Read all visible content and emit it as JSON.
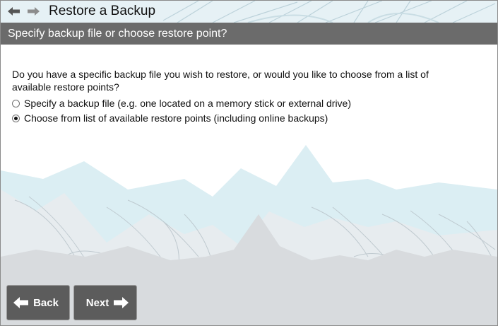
{
  "window": {
    "title": "Restore a Backup",
    "subheader": "Specify backup file or choose restore point?"
  },
  "nav": {
    "back_icon": "arrow-left-icon",
    "forward_icon": "arrow-right-icon"
  },
  "content": {
    "question": "Do you have a specific backup file you wish to restore, or would you like to choose from a list of available restore points?",
    "options": [
      {
        "label": "Specify a backup file (e.g. one located on a memory stick or external drive)",
        "selected": false
      },
      {
        "label": "Choose from list of available restore points (including online backups)",
        "selected": true
      }
    ]
  },
  "buttons": {
    "back_label": "Back",
    "next_label": "Next"
  },
  "colors": {
    "subheader_bg": "#6b6b6b",
    "button_bg": "#5c5c5c",
    "mountain_light": "#dbeef3",
    "mountain_grey": "#d6dadd"
  }
}
